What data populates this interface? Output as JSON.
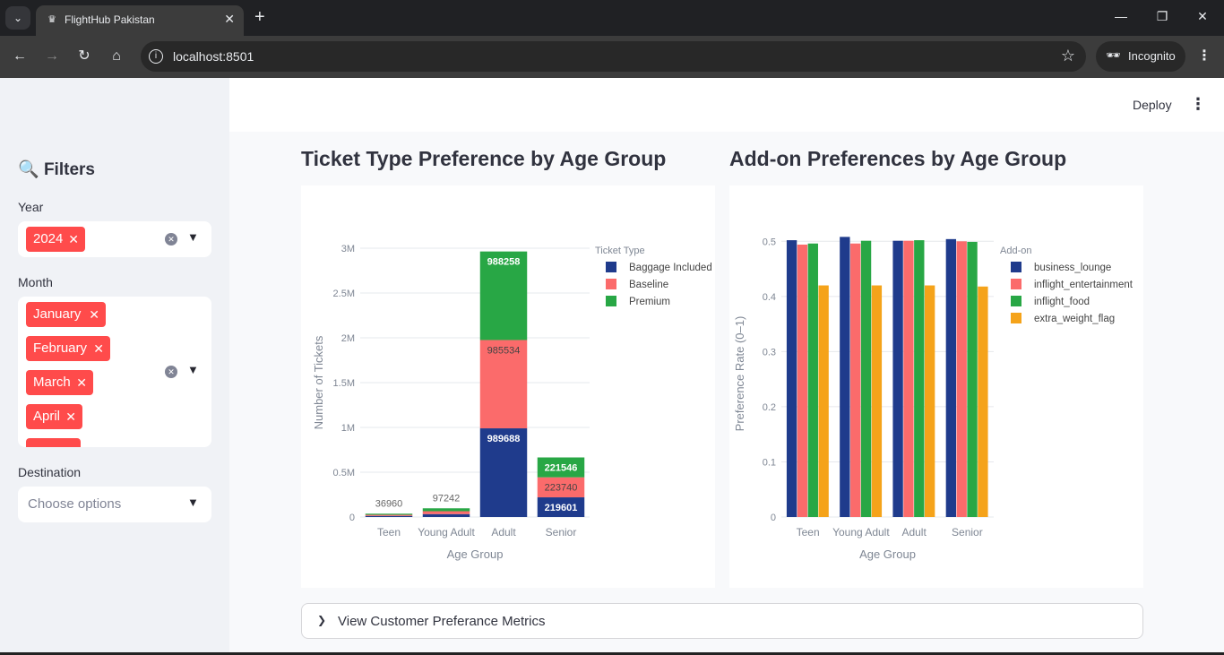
{
  "browser": {
    "tab_title": "FlightHub Pakistan",
    "url": "localhost:8501",
    "profile_label": "Incognito"
  },
  "app": {
    "deploy_label": "Deploy"
  },
  "sidebar": {
    "title": "Filters",
    "year": {
      "label": "Year",
      "selected": [
        "2024"
      ]
    },
    "month": {
      "label": "Month",
      "selected": [
        "January",
        "February",
        "March",
        "April"
      ]
    },
    "destination": {
      "label": "Destination",
      "placeholder": "Choose options"
    }
  },
  "sections": {
    "left_title": "Ticket Type Preference by Age Group",
    "right_title": "Add-on Preferences by Age Group"
  },
  "expander": {
    "label": "View Customer Preferance Metrics"
  },
  "colors": {
    "navy": "#1f3b8c",
    "salmon": "#fb6b6b",
    "green": "#28a745",
    "orange": "#f5a31a",
    "accent": "#ff4b4b"
  },
  "chart_data": [
    {
      "type": "bar",
      "stacked": true,
      "categories": [
        "Teen",
        "Young Adult",
        "Adult",
        "Senior"
      ],
      "series": [
        {
          "name": "Baggage Included",
          "values": [
            12300,
            32400,
            989688,
            219601
          ]
        },
        {
          "name": "Baseline",
          "values": [
            12300,
            32400,
            985534,
            223740
          ]
        },
        {
          "name": "Premium",
          "values": [
            12360,
            32442,
            988258,
            221546
          ]
        }
      ],
      "total_labels": [
        "36960",
        "97242",
        "",
        ""
      ],
      "segment_labels": [
        [
          "",
          "",
          ""
        ],
        [
          "",
          "",
          ""
        ],
        [
          "989688",
          "985534",
          "988258"
        ],
        [
          "219601",
          "223740",
          "221546"
        ]
      ],
      "xlabel": "Age Group",
      "ylabel": "Number of Tickets",
      "legend_title": "Ticket Type",
      "ylim": [
        0,
        3000000
      ],
      "yticks": [
        0,
        500000,
        1000000,
        1500000,
        2000000,
        2500000,
        3000000
      ],
      "ytick_labels": [
        "0",
        "0.5M",
        "1M",
        "1.5M",
        "2M",
        "2.5M",
        "3M"
      ],
      "grid": true,
      "legend_position": "top-right"
    },
    {
      "type": "bar",
      "stacked": false,
      "categories": [
        "Teen",
        "Young Adult",
        "Adult",
        "Senior"
      ],
      "series": [
        {
          "name": "business_lounge",
          "values": [
            0.502,
            0.508,
            0.501,
            0.504
          ]
        },
        {
          "name": "inflight_entertainment",
          "values": [
            0.494,
            0.496,
            0.501,
            0.5
          ]
        },
        {
          "name": "inflight_food",
          "values": [
            0.496,
            0.501,
            0.502,
            0.499
          ]
        },
        {
          "name": "extra_weight_flag",
          "values": [
            0.42,
            0.42,
            0.42,
            0.418
          ]
        }
      ],
      "xlabel": "Age Group",
      "ylabel": "Preference Rate (0–1)",
      "legend_title": "Add-on",
      "ylim": [
        0,
        0.52
      ],
      "yticks": [
        0,
        0.1,
        0.2,
        0.3,
        0.4,
        0.5
      ],
      "ytick_labels": [
        "0",
        "0.1",
        "0.2",
        "0.3",
        "0.4",
        "0.5"
      ],
      "grid": true,
      "legend_position": "top-right"
    }
  ]
}
